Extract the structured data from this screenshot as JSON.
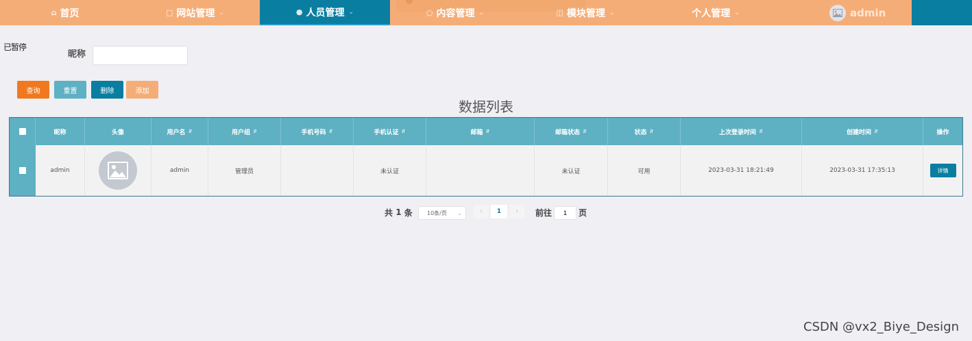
{
  "nav": {
    "items": [
      {
        "label": "首页",
        "icon": "home-icon",
        "has_dropdown": false
      },
      {
        "label": "网站管理",
        "icon": "cart-icon",
        "has_dropdown": true
      },
      {
        "label": "人员管理",
        "icon": "user-icon",
        "has_dropdown": true,
        "active": true
      },
      {
        "label": "内容管理",
        "icon": "chat-icon",
        "has_dropdown": true
      },
      {
        "label": "模块管理",
        "icon": "module-icon",
        "has_dropdown": true
      },
      {
        "label": "个人管理",
        "icon": "",
        "has_dropdown": true
      }
    ],
    "user_name": "admin",
    "colors": {
      "bar": "#f5ad78",
      "active": "#0a7ea0"
    }
  },
  "corner_text": "已暂停",
  "search": {
    "label": "昵称",
    "value": "",
    "placeholder": ""
  },
  "buttons": {
    "query": "查询",
    "reset": "重置",
    "delete": "删除",
    "add": "添加"
  },
  "table": {
    "title": "数据列表",
    "columns": [
      "昵称",
      "头像",
      "用户名",
      "用户组",
      "手机号码",
      "手机认证",
      "邮箱",
      "邮箱状态",
      "状态",
      "上次登录时间",
      "创建时间",
      "操作"
    ],
    "rows": [
      {
        "nickname": "admin",
        "username": "admin",
        "group": "管理员",
        "phone": "",
        "phone_verified": "未认证",
        "email": "",
        "email_status": "未认证",
        "status": "可用",
        "last_login": "2023-03-31 18:21:49",
        "created": "2023-03-31 17:35:13",
        "action": "详情"
      }
    ]
  },
  "pagination": {
    "total_prefix": "共",
    "total": "1",
    "total_suffix": "条",
    "page_size": "10条/页",
    "current": "1",
    "goto_label": "前往",
    "goto_value": "1",
    "page_suffix": "页"
  },
  "watermark": "CSDN @vx2_Biye_Design"
}
